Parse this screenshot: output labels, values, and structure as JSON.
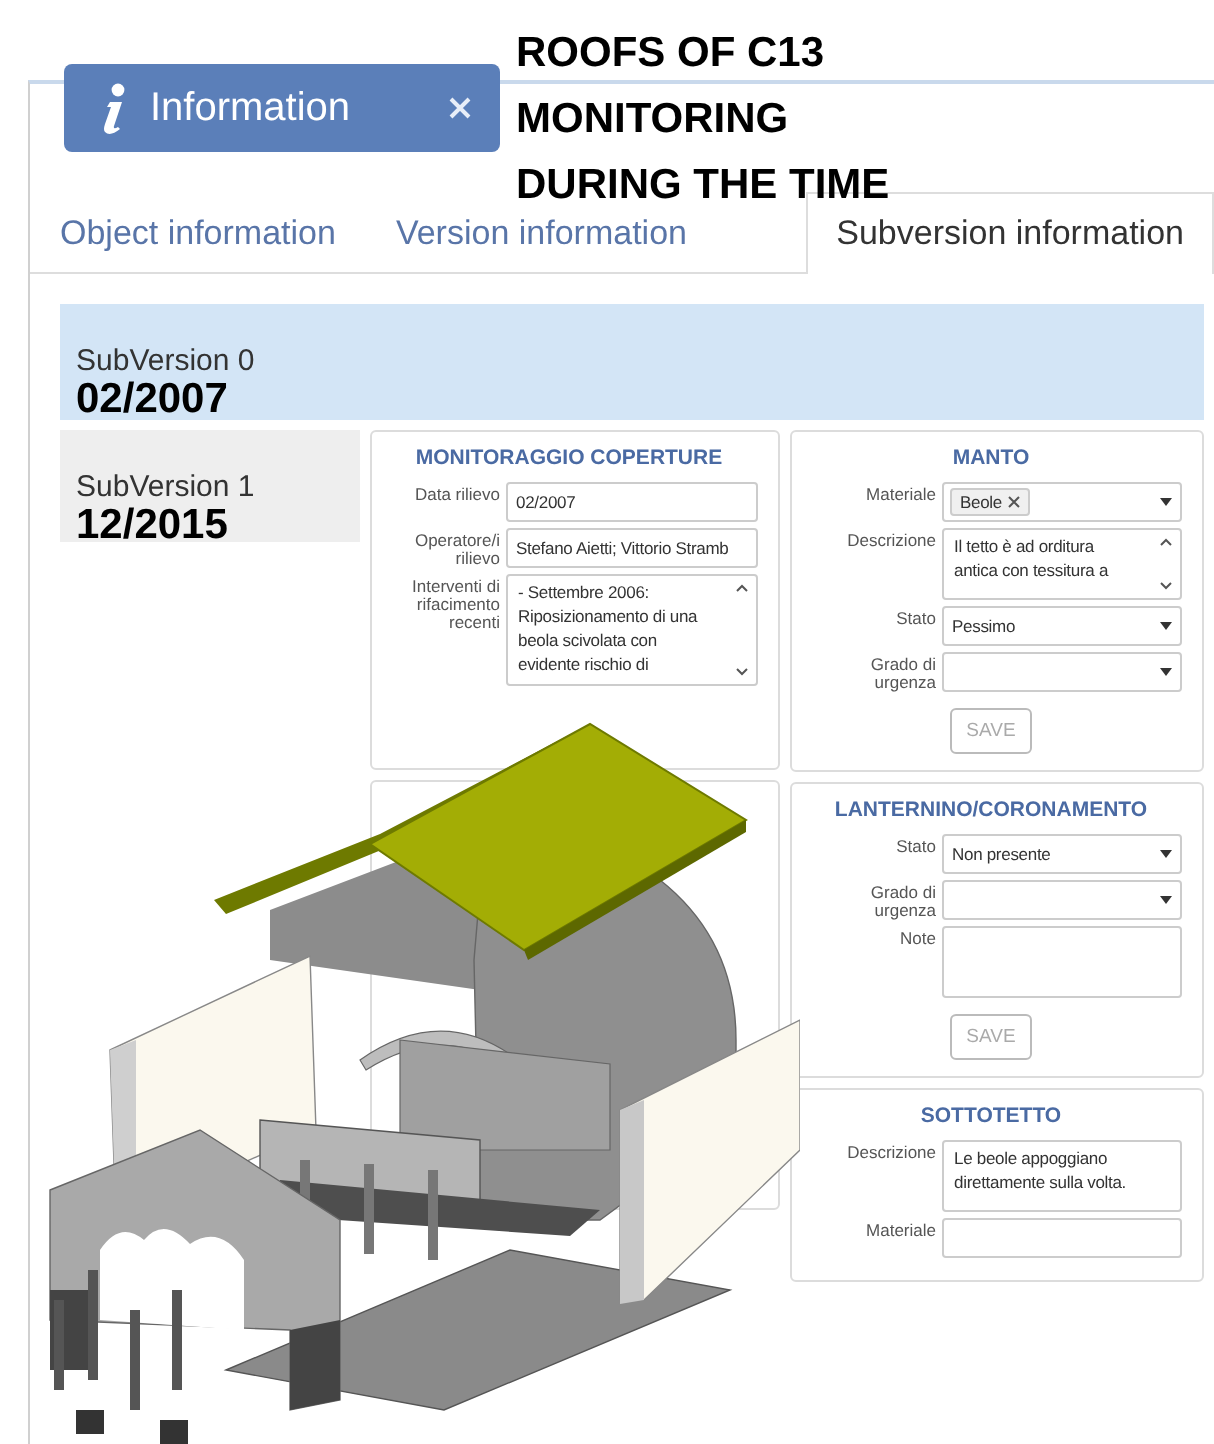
{
  "annotation": {
    "title": "ROOFS OF C13\nMONITORING\nDURING THE TIME"
  },
  "window": {
    "title": "Information"
  },
  "tabs": [
    {
      "label": "Object information",
      "selected": false
    },
    {
      "label": "Version information",
      "selected": false
    },
    {
      "label": "Subversion information",
      "selected": true
    }
  ],
  "subversions": [
    {
      "label": "SubVersion 0",
      "date": "02/2007",
      "selected": true
    },
    {
      "label": "SubVersion 1",
      "date": "12/2015",
      "selected": false
    }
  ],
  "columns": [
    [
      {
        "title": "MONITORAGGIO COPERTURE",
        "fields": [
          {
            "kind": "input",
            "label": "Data rilievo",
            "value": "02/2007"
          },
          {
            "kind": "input",
            "label": "Operatore/i rilievo",
            "value": "Stefano Aietti; Vittorio Stramb"
          },
          {
            "kind": "textarea",
            "label": "Interventi di rifacimento recenti",
            "value": "- Settembre 2006: Riposizionamento  di una beola scivolata con evidente rischio di",
            "scrollable": true
          }
        ]
      },
      {}
    ],
    [
      {
        "title": "MANTO",
        "fields": [
          {
            "kind": "tags",
            "label": "Materiale",
            "tag": "Beole"
          },
          {
            "kind": "textarea",
            "label": "Descrizione",
            "value": "Il tetto è ad orditura antica con tessitura a",
            "scrollable": true
          },
          {
            "kind": "select",
            "label": "Stato",
            "value": "Pessimo"
          },
          {
            "kind": "select",
            "label": "Grado di urgenza"
          }
        ],
        "save": "SAVE"
      },
      {
        "title": "LANTERNINO/CORONAMENTO",
        "fields": [
          {
            "kind": "select",
            "label": "Stato",
            "value": "Non presente"
          },
          {
            "kind": "select",
            "label": "Grado di urgenza"
          },
          {
            "kind": "textarea",
            "label": "Note",
            "scrollable": false
          }
        ],
        "save": "SAVE"
      },
      {
        "title": "SOTTOTETTO",
        "fields": [
          {
            "kind": "textarea",
            "label": "Descrizione",
            "value": "Le beole appoggiano direttamente sulla volta.",
            "scrollable": false
          },
          {
            "kind": "input",
            "label": "Materiale"
          }
        ]
      }
    ]
  ]
}
